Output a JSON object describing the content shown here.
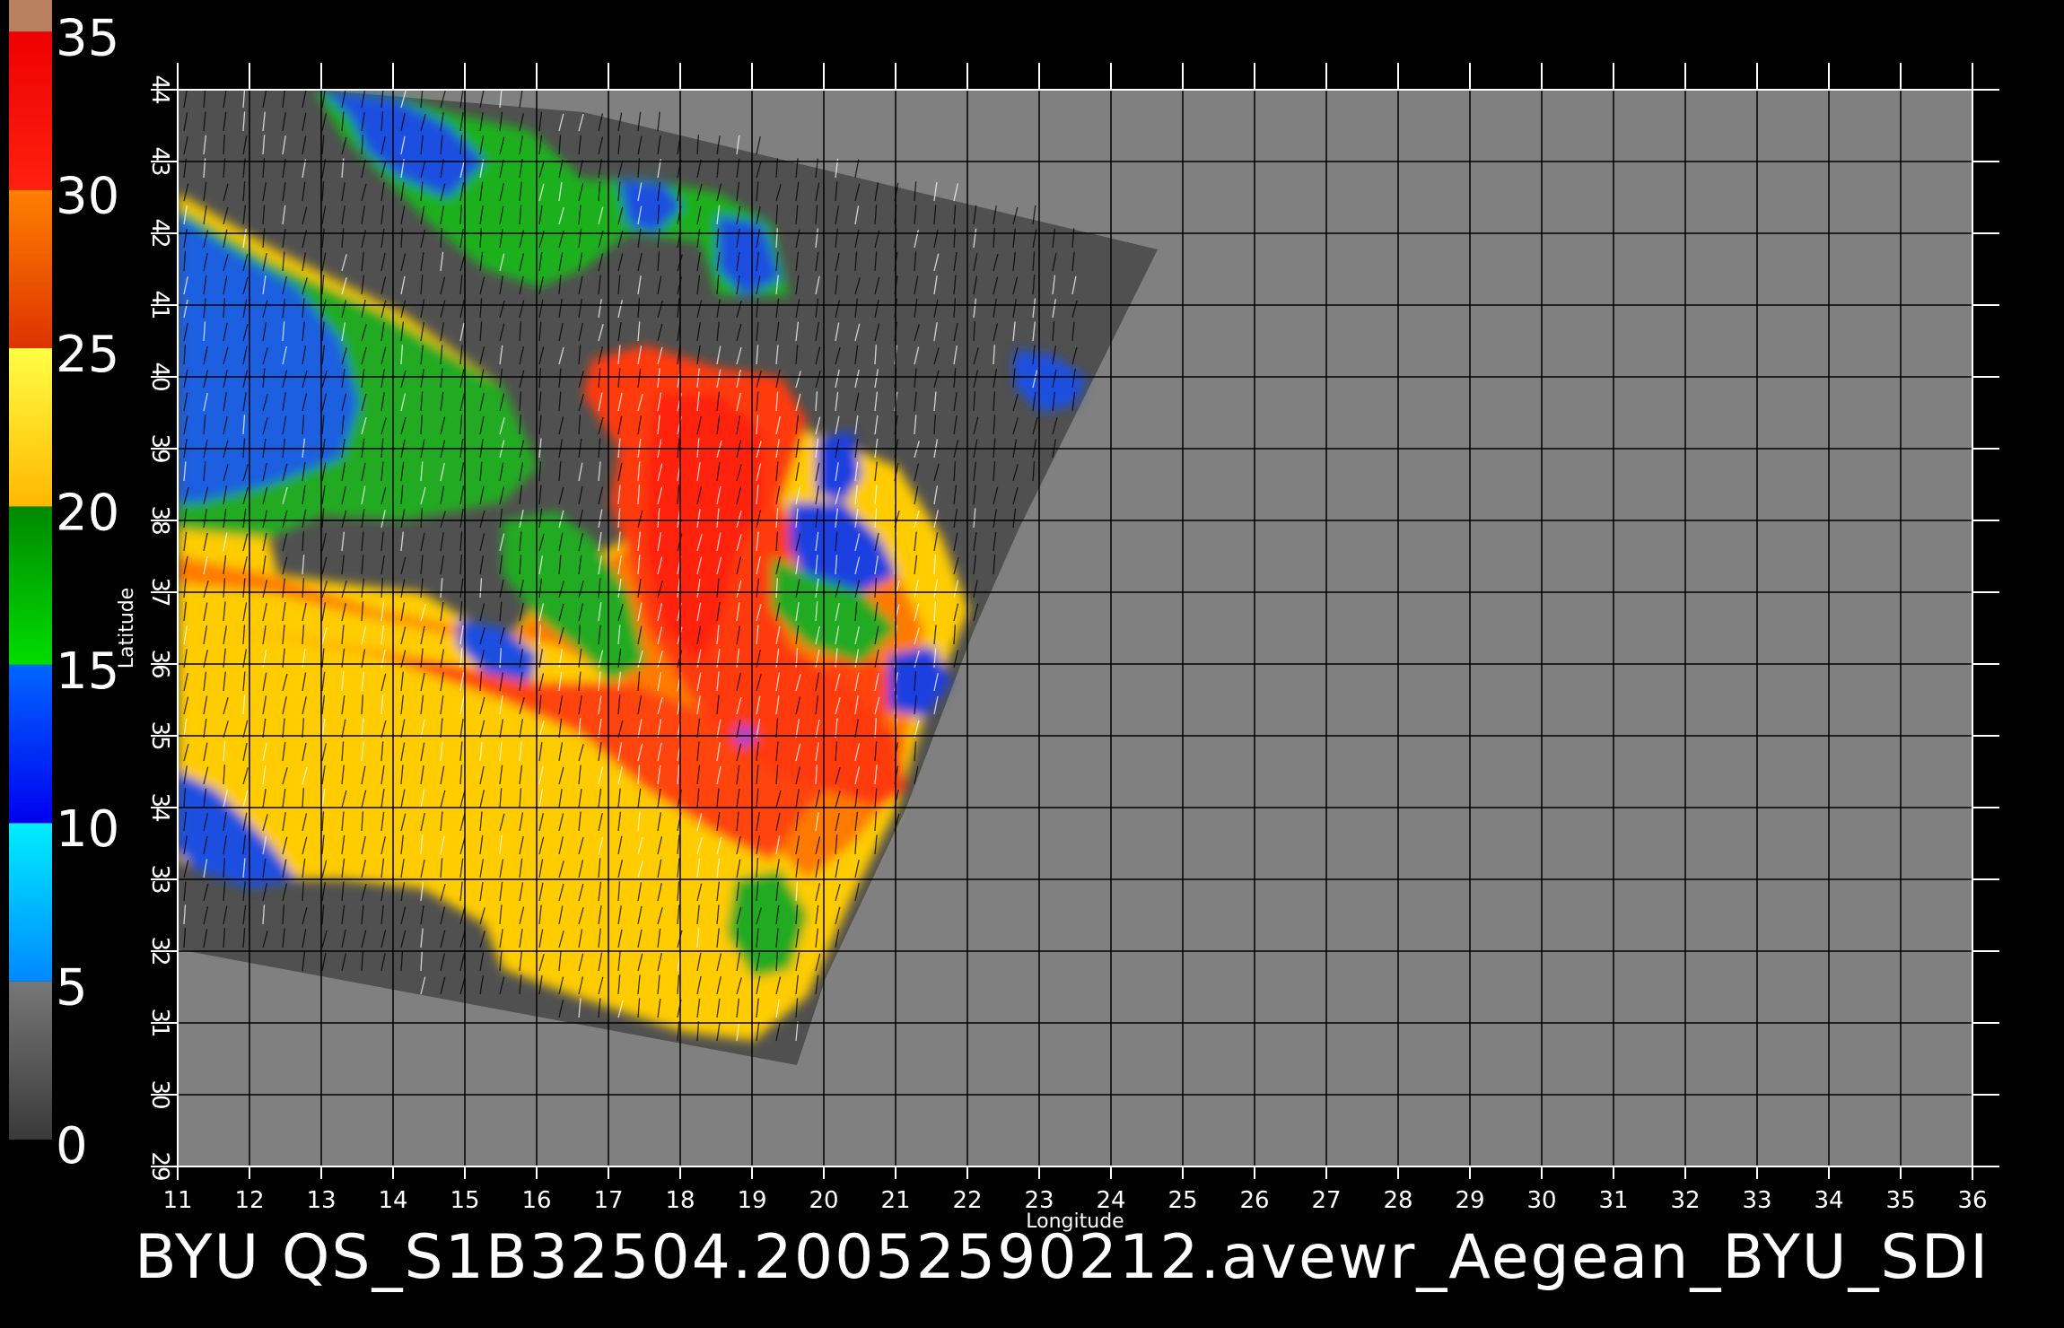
{
  "colorbar": {
    "ticks": [
      "35",
      "30",
      "25",
      "20",
      "15",
      "10",
      "5",
      "0"
    ],
    "stops": [
      {
        "from": 0,
        "to": 5,
        "color": "#777777",
        "color2": "#3a3a3a"
      },
      {
        "from": 5,
        "to": 10,
        "color": "#00eeff",
        "color2": "#0088ff"
      },
      {
        "from": 10,
        "to": 15,
        "color": "#0066ff",
        "color2": "#0000ee"
      },
      {
        "from": 15,
        "to": 20,
        "color": "#008800",
        "color2": "#00dd00"
      },
      {
        "from": 20,
        "to": 25,
        "color": "#ffff44",
        "color2": "#ffb800"
      },
      {
        "from": 25,
        "to": 30,
        "color": "#ff8000",
        "color2": "#dd3300"
      },
      {
        "from": 30,
        "to": 35,
        "color": "#ee0000",
        "color2": "#ff2010"
      },
      {
        "from": 35,
        "to": 36,
        "color": "#b98060",
        "color2": "#b98060"
      }
    ]
  },
  "map": {
    "lon_range": [
      11,
      36
    ],
    "lat_range": [
      29,
      44
    ],
    "lon_ticks": [
      "11",
      "12",
      "13",
      "14",
      "15",
      "16",
      "17",
      "18",
      "19",
      "20",
      "21",
      "22",
      "23",
      "24",
      "25",
      "26",
      "27",
      "28",
      "29",
      "30",
      "31",
      "32",
      "33",
      "34",
      "35",
      "36"
    ],
    "lat_ticks": [
      "29",
      "30",
      "31",
      "32",
      "33",
      "34",
      "35",
      "36",
      "37",
      "38",
      "39",
      "40",
      "41",
      "42",
      "43",
      "44"
    ],
    "xlabel": "Longitude",
    "ylabel": "Latitude",
    "background_color": "#808080",
    "swath_color": "#505050",
    "grid_color": "#000000"
  },
  "caption": "BYU  QS_S1B32504.20052590212.avewr_Aegean_BYU_SDI"
}
